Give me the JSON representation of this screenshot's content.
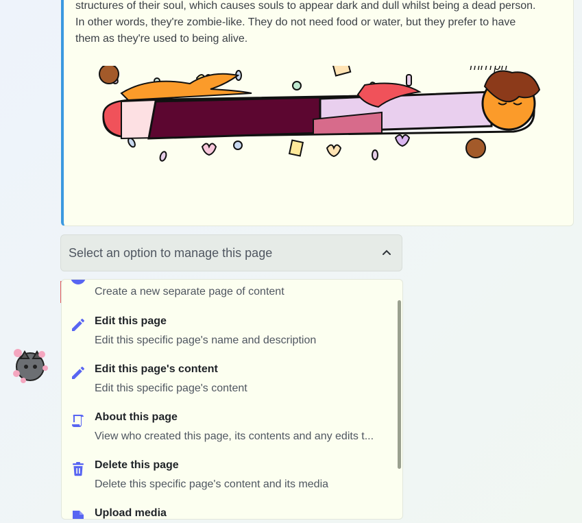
{
  "embed": {
    "text_lines": [
      "structures of their soul, which causes souls to appear dark and dull whilst being a dead person.",
      "In other words, they're zombie-like. They do not need food or water, but they prefer to have",
      "them as they're used to being alive."
    ],
    "image_caption": "mrrrph",
    "accent_color": "#3b99e0"
  },
  "select": {
    "placeholder": "Select an option to manage this page",
    "chevron_icon": "chevron-up-icon"
  },
  "options": [
    {
      "title": "",
      "description": "Create a new separate page of content",
      "icon": "plus-circle-icon"
    },
    {
      "title": "Edit this page",
      "description": "Edit this specific page's name and description",
      "icon": "pencil-icon"
    },
    {
      "title": "Edit this page's content",
      "description": "Edit this specific page's content",
      "icon": "pencil-icon"
    },
    {
      "title": "About this page",
      "description": "View who created this page, its contents and any edits t...",
      "icon": "scroll-icon"
    },
    {
      "title": "Delete this page",
      "description": "Delete this specific page's content and its media",
      "icon": "trash-icon"
    },
    {
      "title": "Upload media",
      "description": "",
      "icon": "upload-file-icon"
    }
  ],
  "colors": {
    "icon": "#5865f2",
    "panel_bg": "#fcfff0"
  }
}
